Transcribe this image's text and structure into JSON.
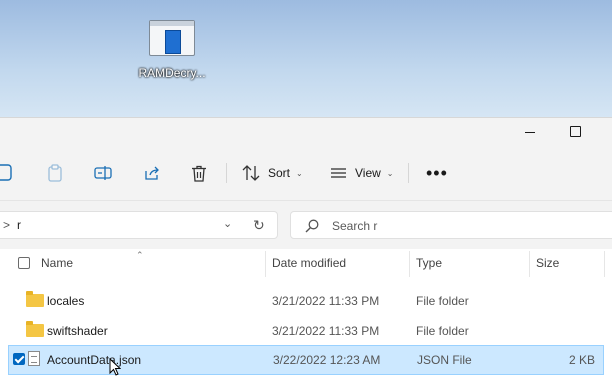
{
  "desktop": {
    "shortcut_label": "RAMDecry..."
  },
  "toolbar": {
    "sort_label": "Sort",
    "view_label": "View",
    "more_label": "•••"
  },
  "address": {
    "arrow": ">",
    "path": "r",
    "dropdown": "⌄",
    "refresh": "↻"
  },
  "search": {
    "placeholder": "Search r"
  },
  "columns": {
    "name": "Name",
    "date": "Date modified",
    "type": "Type",
    "size": "Size"
  },
  "files": [
    {
      "name": "locales",
      "date": "3/21/2022 11:33 PM",
      "type": "File folder",
      "size": "",
      "selected": false
    },
    {
      "name": "swiftshader",
      "date": "3/21/2022 11:33 PM",
      "type": "File folder",
      "size": "",
      "selected": false
    },
    {
      "name": "AccountData.json",
      "date": "3/22/2022 12:23 AM",
      "type": "JSON File",
      "size": "2 KB",
      "selected": true
    }
  ],
  "colors": {
    "selection": "#cce8ff",
    "accent": "#0067c0",
    "folder": "#f4c644"
  }
}
